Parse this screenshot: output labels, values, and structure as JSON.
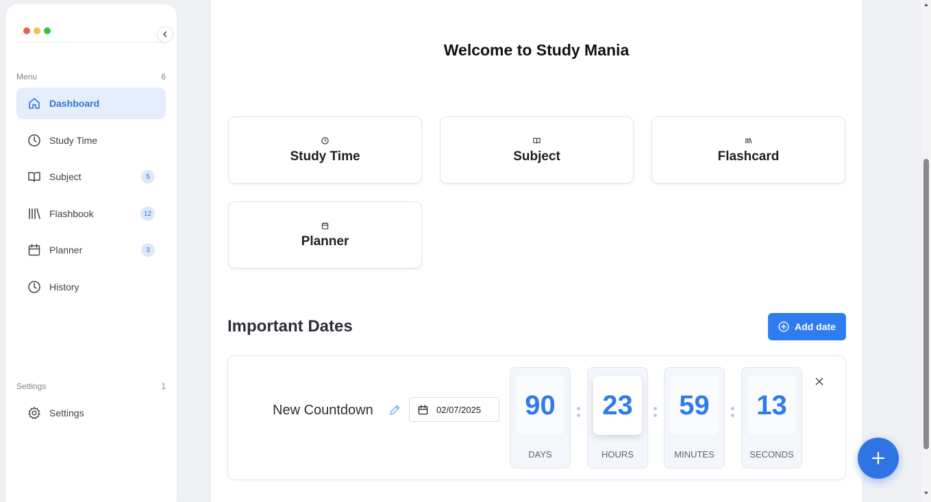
{
  "window": {
    "dot_colors": [
      "#ee5f57",
      "#f5be4f",
      "#28c840"
    ]
  },
  "sidebar": {
    "menu_label": "Menu",
    "menu_count": "6",
    "items": [
      {
        "label": "Dashboard",
        "icon": "home-icon",
        "active": true
      },
      {
        "label": "Study Time",
        "icon": "clock-icon"
      },
      {
        "label": "Subject",
        "icon": "book-icon",
        "badge": "5"
      },
      {
        "label": "Flashbook",
        "icon": "library-icon",
        "badge": "12"
      },
      {
        "label": "Planner",
        "icon": "calendar-icon",
        "badge": "3"
      },
      {
        "label": "History",
        "icon": "clock-icon"
      }
    ],
    "settings_label": "Settings",
    "settings_count": "1",
    "settings_item": "Settings"
  },
  "main": {
    "welcome": "Welcome to Study Mania",
    "cards": [
      {
        "title": "Study Time",
        "icon": "clock-icon"
      },
      {
        "title": "Subject",
        "icon": "book-icon"
      },
      {
        "title": "Flashcard",
        "icon": "library-icon"
      },
      {
        "title": "Planner",
        "icon": "calendar-icon"
      }
    ],
    "important_dates_title": "Important Dates",
    "add_date_label": "Add date",
    "countdown": {
      "name": "New Countdown",
      "date": "02/07/2025",
      "units": [
        {
          "value": "90",
          "label": "DAYS"
        },
        {
          "value": "23",
          "label": "HOURS"
        },
        {
          "value": "59",
          "label": "MINUTES"
        },
        {
          "value": "13",
          "label": "SECONDS"
        }
      ]
    }
  },
  "colors": {
    "accent": "#2f7cf0",
    "active_bg": "#e4edfb"
  }
}
